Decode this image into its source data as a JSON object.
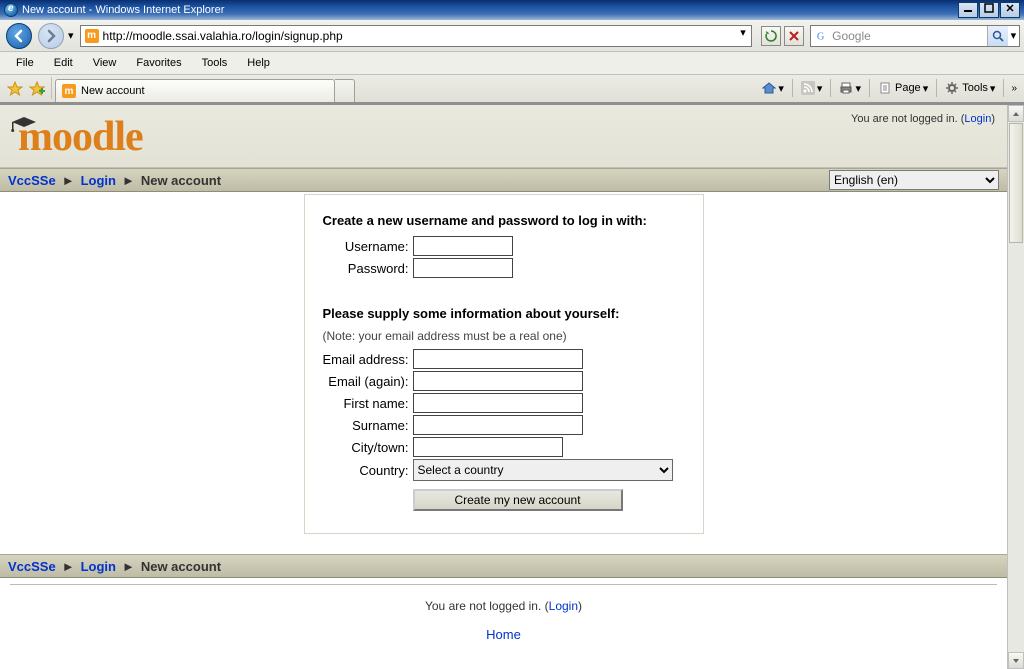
{
  "window": {
    "title": "New account - Windows Internet Explorer"
  },
  "address": {
    "url": "http://moodle.ssai.valahia.ro/login/signup.php"
  },
  "search": {
    "placeholder": "Google"
  },
  "menubar": {
    "file": "File",
    "edit": "Edit",
    "view": "View",
    "favorites": "Favorites",
    "tools": "Tools",
    "help": "Help"
  },
  "tab": {
    "title": "New account"
  },
  "cmdbar": {
    "page": "Page",
    "tools": "Tools"
  },
  "moodle": {
    "login_status_prefix": "You are not logged in. (",
    "login_link": "Login",
    "login_status_suffix": ")",
    "logo_text": "moodle"
  },
  "breadcrumb": {
    "root": "VccSSe",
    "login": "Login",
    "current": "New account"
  },
  "lang": {
    "selected": "English (en)"
  },
  "form": {
    "section1_title": "Create a new username and password to log in with:",
    "username_label": "Username:",
    "password_label": "Password:",
    "section2_title": "Please supply some information about yourself:",
    "note": "(Note: your email address must be a real one)",
    "email_label": "Email address:",
    "email2_label": "Email (again):",
    "firstname_label": "First name:",
    "surname_label": "Surname:",
    "city_label": "City/town:",
    "country_label": "Country:",
    "country_selected": "Select a country",
    "submit": "Create my new account"
  },
  "footer": {
    "status_prefix": "You are not logged in. (",
    "login": "Login",
    "status_suffix": ")",
    "home": "Home"
  }
}
